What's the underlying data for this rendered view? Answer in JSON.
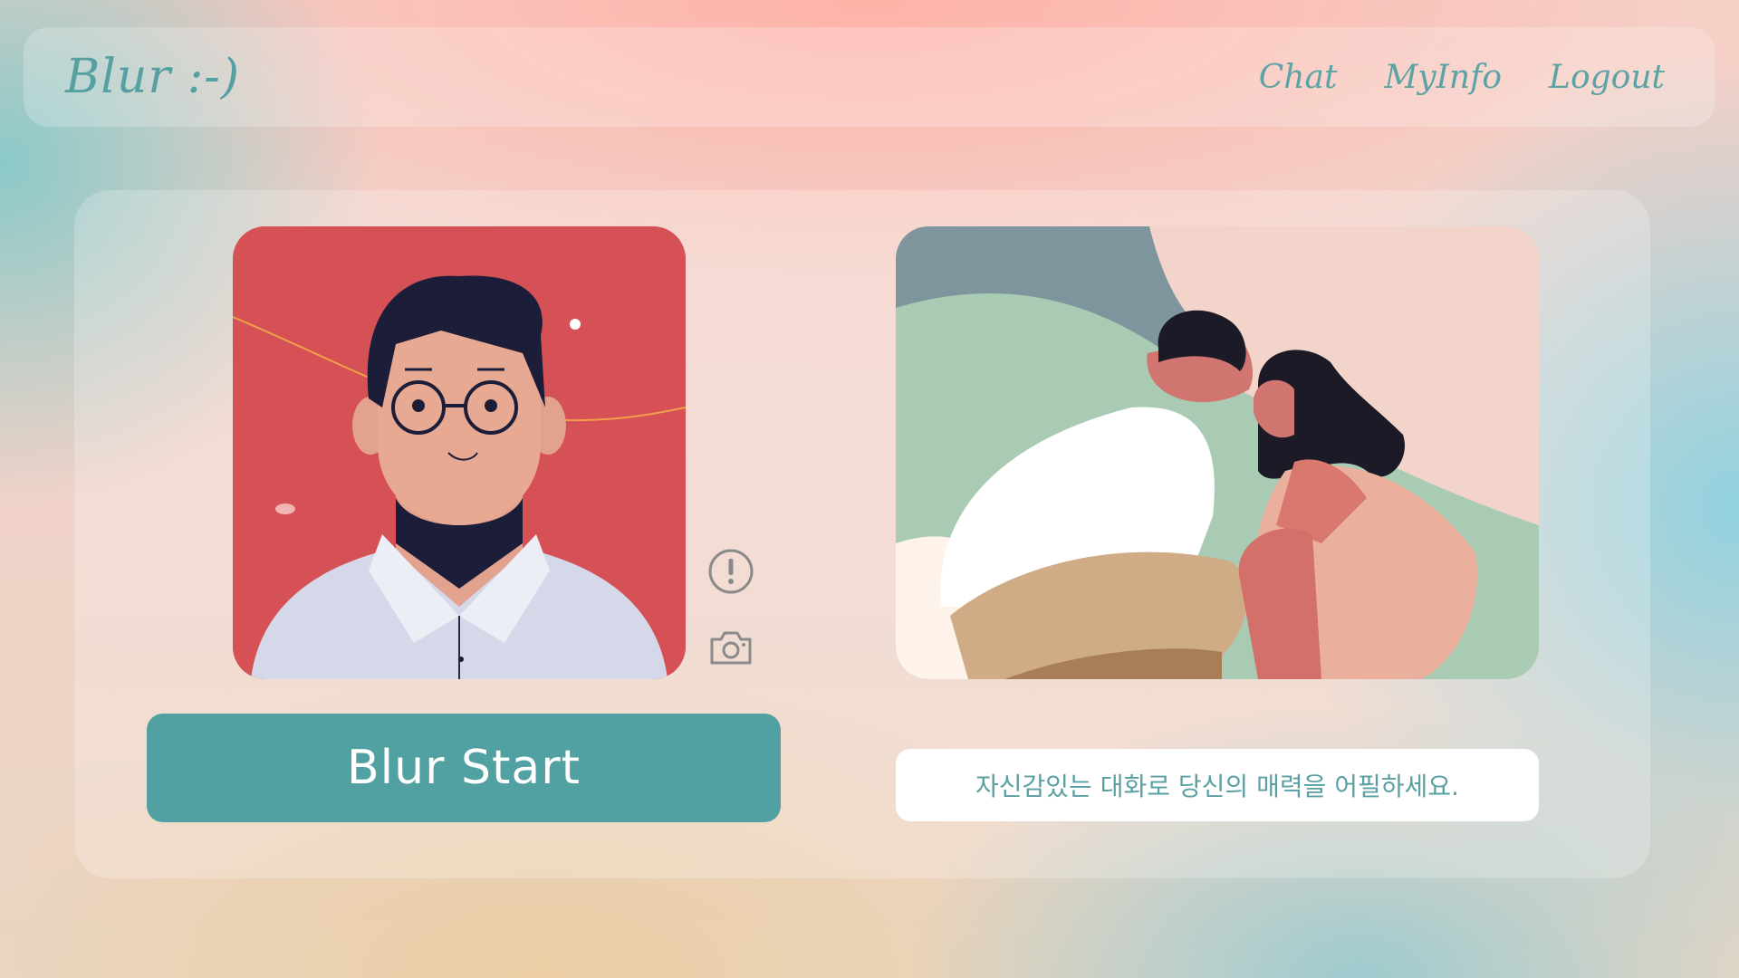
{
  "header": {
    "logo": "Blur :-)",
    "nav": [
      {
        "label": "Chat"
      },
      {
        "label": "MyInfo"
      },
      {
        "label": "Logout"
      }
    ]
  },
  "main": {
    "blur_start_label": "Blur Start",
    "tagline": "자신감있는 대화로 당신의 매력을 어필하세요.",
    "icons": [
      "alert-circle-icon",
      "camera-icon"
    ]
  },
  "colors": {
    "accent": "#51a1a3",
    "profile_bg": "#d65155",
    "text_teal": "#5aa0a3"
  }
}
